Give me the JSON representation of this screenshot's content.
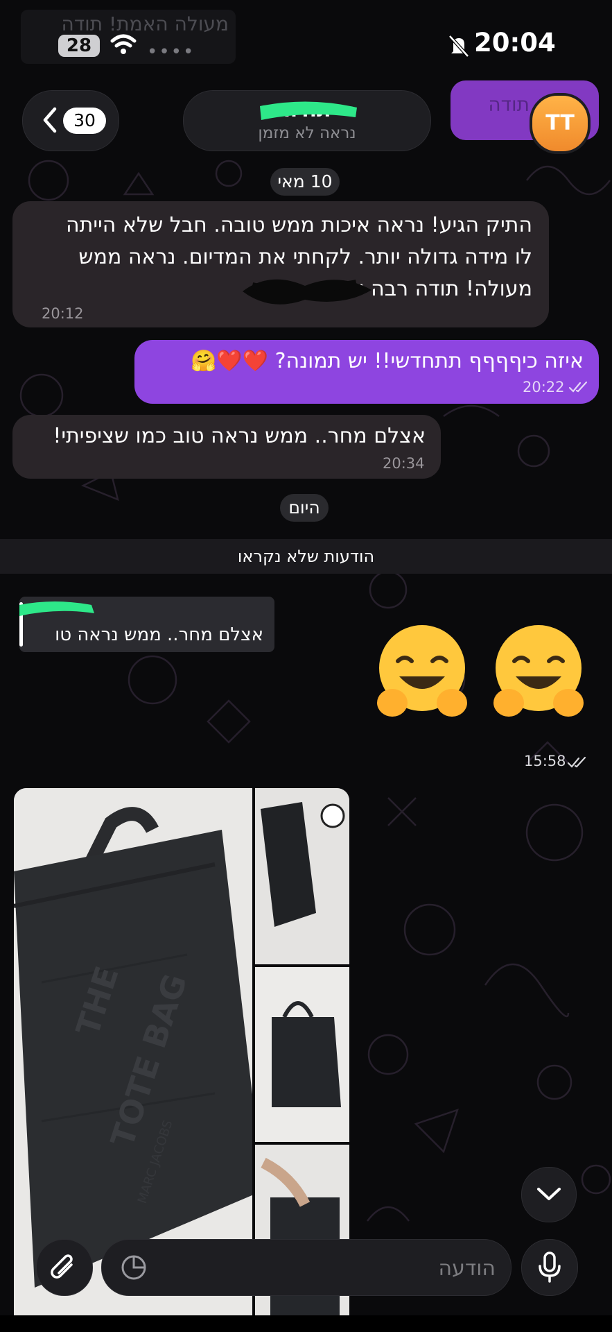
{
  "status_bar": {
    "battery": "28",
    "time": "20:04",
    "dots": "••••",
    "faded_overlay_text": "מעולה האמת! תודה"
  },
  "header": {
    "back_count": "30",
    "contact_name": "תודה",
    "contact_status": "נראה לא מזמן",
    "avatar_initials": "TT",
    "peek_text": "תודה"
  },
  "chat": {
    "date_chip_1": "10 מאי",
    "msg_1": {
      "line1": "התיק הגיע! נראה איכות ממש טובה. חבל שלא הייתה",
      "line2": "לו מידה גדולה יותר. לקחתי את המדיום. נראה ממש",
      "line3": "מעולה! תודה רבה על",
      "time": "20:12"
    },
    "msg_2": {
      "text": "איזה כיףףףף תתחדשי!! יש תמונה? ❤️❤️🤗",
      "time": "20:22"
    },
    "msg_3": {
      "text": "אצלם מחר.. ממש נראה טוב כמו שציפיתי!",
      "time": "20:34"
    },
    "date_chip_2": "היום",
    "unread_label": "הודעות שלא נקראו",
    "reply": {
      "quoted_text": "אצלם מחר.. ממש נראה טו"
    },
    "emoji_msg": {
      "time": "15:58"
    }
  },
  "photo_album": {
    "bag_text_line1": "THE",
    "bag_text_line2": "TOTE BAG",
    "bag_brand": "MARC JACOBS"
  },
  "composer": {
    "placeholder": "הודעה"
  },
  "colors": {
    "outgoing": "#8e45e0",
    "incoming": "#2a2529",
    "background": "#0a0a0c",
    "avatar": "#f5a13a"
  }
}
